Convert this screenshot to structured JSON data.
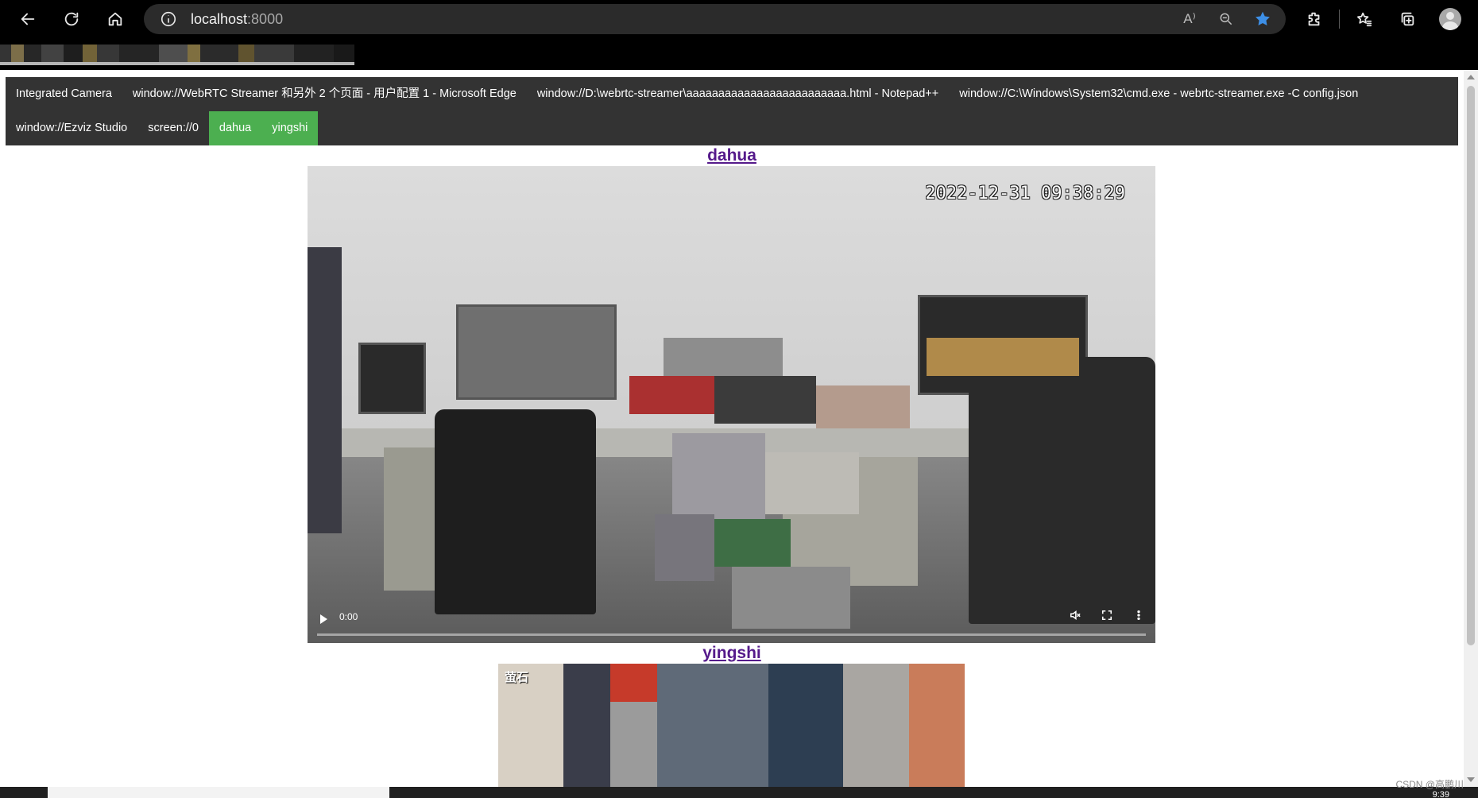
{
  "browser": {
    "address": {
      "host": "localhost",
      "port": ":8000"
    },
    "read_aloud_label": "A⁾",
    "colors": {
      "favorite_star": "#3d8fe6",
      "active_tab": "#4caf50",
      "nav_bg": "#333333",
      "link_visited": "#551a8b"
    }
  },
  "streams": {
    "items": [
      {
        "label": "Integrated Camera",
        "active": false
      },
      {
        "label": "window://WebRTC Streamer 和另外 2 个页面 - 用户配置 1 - Microsoft Edge",
        "active": false
      },
      {
        "label": "window://D:\\webrtc-streamer\\aaaaaaaaaaaaaaaaaaaaaaaaa.html - Notepad++",
        "active": false
      },
      {
        "label": "window://C:\\Windows\\System32\\cmd.exe - webrtc-streamer.exe -C config.json",
        "active": false
      },
      {
        "label": "window://Ezviz Studio",
        "active": false
      },
      {
        "label": "screen://0",
        "active": false
      },
      {
        "label": "dahua",
        "active": true
      },
      {
        "label": "yingshi",
        "active": true
      }
    ]
  },
  "videos": {
    "dahua": {
      "title": "dahua",
      "timestamp": "2022-12-31 09:38:29",
      "time": "0:00",
      "progress": 0
    },
    "yingshi": {
      "title": "yingshi",
      "logo": "萤石"
    }
  },
  "taskbar": {
    "watermark": "CSDN @高鹏川",
    "clock": "9:39"
  }
}
